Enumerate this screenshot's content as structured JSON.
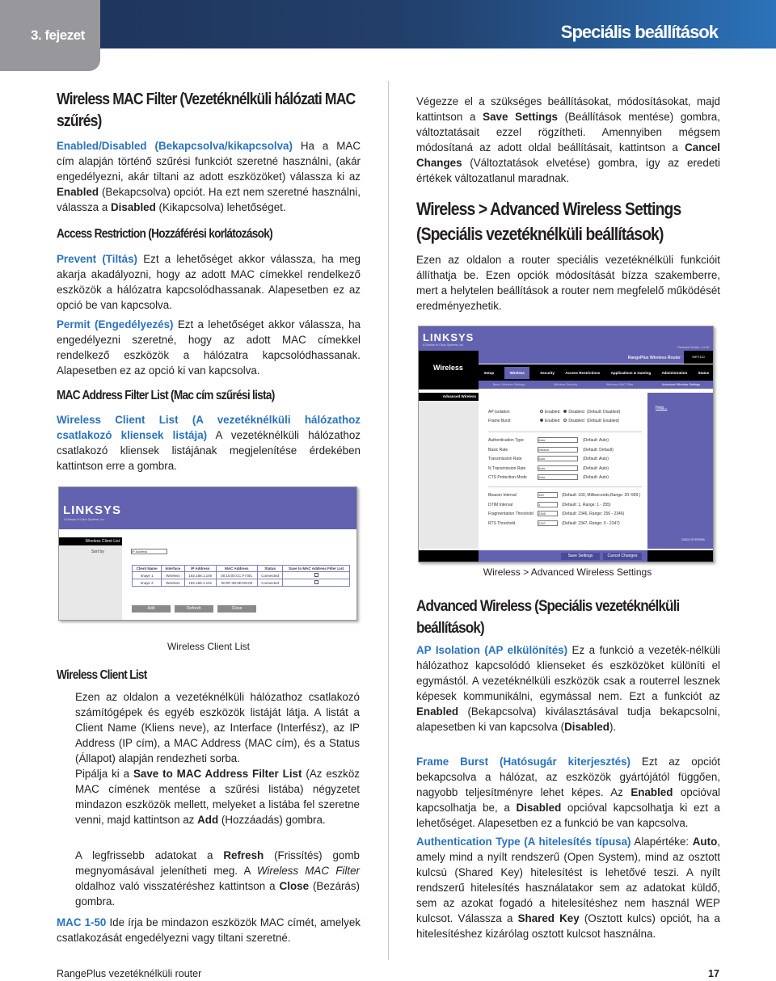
{
  "header": {
    "chapter": "3. fejezet",
    "title": "Speciális beállítások"
  },
  "colors": {
    "accent_blue": "#2a72bd",
    "header_dark": "#1e3358",
    "header_light": "#2b72b9",
    "tab_gray": "#98989c",
    "router_purple": "#6262b0"
  },
  "left": {
    "h_mac_filter": "Wireless MAC Filter (Vezetéknélküli hálózati MAC szűrés)",
    "p_enabled": [
      {
        "t": "Enabled/Disabled (Bekapcsolva/kikapcsolva)",
        "s": "blue"
      },
      {
        "t": " Ha a MAC cím alapján történő szűrési funkciót szeretné használni, (akár engedélyezni, akár tiltani az adott eszközöket) válassza ki az "
      },
      {
        "t": "Enabled",
        "s": "b"
      },
      {
        "t": " (Bekapcsolva) opciót. Ha ezt nem szeretné használni, válassza a "
      },
      {
        "t": "Disabled",
        "s": "b"
      },
      {
        "t": " (Kikapcsolva) lehetőséget."
      }
    ],
    "h_access": "Access Restriction (Hozzáférési korlátozások)",
    "p_prevent": [
      {
        "t": "Prevent (Tiltás)",
        "s": "blue"
      },
      {
        "t": " Ezt a lehetőséget akkor válassza, ha meg akarja akadályozni, hogy az adott MAC címekkel rendelkező eszközök a hálózatra kapcsolódhassanak. Alapesetben ez az opció be van kapcsolva."
      }
    ],
    "p_permit": [
      {
        "t": "Permit (Engedélyezés)",
        "s": "blue"
      },
      {
        "t": " Ezt a lehetőséget akkor válassza, ha engedélyezni szeretné, hogy az adott MAC címekkel rendelkező eszközök a hálózatra kapcsolódhassanak. Alapesetben ez az opció ki van kapcsolva."
      }
    ],
    "h_list": "MAC Address Filter List (Mac cím szűrési lista)",
    "p_client": [
      {
        "t": "Wireless Client List (A vezetéknélküli hálózathoz csatlakozó kliensek listája)",
        "s": "blue"
      },
      {
        "t": " A vezetéknélküli hálózathoz csatlakozó kliensek listájának megjelenítése érdekében kattintson erre a gombra."
      }
    ],
    "caption": "Wireless Client List",
    "h_wcl": "Wireless Client List",
    "p_wcl1": [
      {
        "t": "Ezen az oldalon a vezetéknélküli hálózathoz csatlakozó számítógépek és egyéb eszközök listáját látja. A listát a Client Name (Kliens neve), az Interface (Interfész), az IP Address (IP cím), a MAC Address (MAC cím), és a Status (Állapot) alapján rendezheti sorba."
      }
    ],
    "p_wcl2": [
      {
        "t": "Pipálja ki a "
      },
      {
        "t": "Save to MAC Address Filter List",
        "s": "b"
      },
      {
        "t": " (Az eszköz MAC címének mentése a szűrési listába) négyzetet mindazon eszközök mellett, melyeket a listába fel szeretne venni, majd kattintson az "
      },
      {
        "t": "Add",
        "s": "b"
      },
      {
        "t": " (Hozzáadás) gombra."
      }
    ],
    "p_wcl3": [
      {
        "t": "A legfrissebb adatokat a "
      },
      {
        "t": "Refresh",
        "s": "b"
      },
      {
        "t": " (Frissítés) gomb megnyomásával jelenítheti meg. A "
      },
      {
        "t": "Wireless MAC Filter",
        "s": "i"
      },
      {
        "t": " oldalhoz való visszatéréshez kattintson a "
      },
      {
        "t": "Close",
        "s": "b"
      },
      {
        "t": " (Bezárás) gombra."
      }
    ],
    "p_mac150": [
      {
        "t": "MAC 1-50",
        "s": "blue"
      },
      {
        "t": " Ide írja be mindazon eszközök MAC címét, amelyek csatlakozását engedélyezni vagy tiltani szeretné."
      }
    ]
  },
  "right": {
    "p_save": [
      {
        "t": "Végezze el a szükséges beállításokat, módosításokat, majd kattintson a "
      },
      {
        "t": "Save Settings",
        "s": "b"
      },
      {
        "t": " (Beállítások mentése) gombra, változtatásait ezzel rögzítheti. Amennyiben mégsem módosítaná az adott oldal beállításait, kattintson a "
      },
      {
        "t": "Cancel Changes",
        "s": "b"
      },
      {
        "t": " (Változtatások elvetése) gombra, így az eredeti értékek változatlanul maradnak."
      }
    ],
    "h_adv_settings": "Wireless > Advanced Wireless Settings (Speciális vezetéknélküli beállítások)",
    "p_intro": [
      {
        "t": "Ezen az oldalon a router speciális vezetéknélküli funkcióit állíthatja be. Ezen opciók módosítását bízza szakemberre, mert a helytelen beállítások a router nem megfelelő működését eredményezhetik."
      }
    ],
    "caption": "Wireless > Advanced Wireless Settings",
    "h_adv": "Advanced Wireless (Speciális vezetéknélküli beállítások)",
    "p_ap": [
      {
        "t": "AP Isolation (AP elkülönítés)",
        "s": "blue"
      },
      {
        "t": " Ez a funkció a vezeték-nélküli hálózathoz kapcsolódó klienseket és eszközöket különíti el egymástól. A vezetéknélküli eszközök csak a routerrel lesznek képesek kommunikálni, egymással nem. Ezt a funkciót az "
      },
      {
        "t": "Enabled",
        "s": "b"
      },
      {
        "t": " (Bekapcsolva) kiválasztásával tudja bekapcsolni, alapesetben ki van kapcsolva ("
      },
      {
        "t": "Disabled",
        "s": "b"
      },
      {
        "t": ")."
      }
    ],
    "p_frame": [
      {
        "t": "Frame Burst (Hatósugár kiterjesztés)",
        "s": "blue"
      },
      {
        "t": " Ezt az opciót bekapcsolva a hálózat, az eszközök gyártójától függően, nagyobb teljesítményre lehet képes. Az "
      },
      {
        "t": "Enabled",
        "s": "b"
      },
      {
        "t": " opcióval kapcsolhatja be, a "
      },
      {
        "t": "Disabled",
        "s": "b"
      },
      {
        "t": " opcióval kapcsolhatja ki ezt a lehetőséget. Alapesetben ez a funkció be van kapcsolva."
      }
    ],
    "p_auth": [
      {
        "t": "Authentication Type (A hitelesítés típusa)",
        "s": "blue"
      },
      {
        "t": " Alapértéke: "
      },
      {
        "t": "Auto",
        "s": "b"
      },
      {
        "t": ", amely mind a nyílt rendszerű (Open System), mind az osztott kulcsú (Shared Key) hitelesítést is lehetővé teszi. A nyílt rendszerű hitelesítés használatakor sem az adatokat küldő, sem az azokat fogadó a hitelesítéshez nem használ WEP kulcsot. Válassza a "
      },
      {
        "t": "Shared Key",
        "s": "b"
      },
      {
        "t": " (Osztott kulcs) opciót, ha a hitelesítéshez kizárólag osztott kulcsot használna."
      }
    ]
  },
  "client_shot": {
    "logo": "LINKSYS",
    "logo_sub": "A Division of Cisco Systems, Inc.",
    "section": "Wireless Client List",
    "sort_label": "Sort by",
    "sort_value": "IP Address",
    "columns": [
      "Client Name",
      "Interface",
      "IP Address",
      "MAC Address",
      "Status",
      "Save to MAC Address Filter List"
    ],
    "rows": [
      [
        "Imaye 1",
        "Wireless",
        "192.168.1.100",
        "00:15:00:CC:F7:BC",
        "Connected"
      ],
      [
        "Imaye 2",
        "Wireless",
        "192.168.1.101",
        "00:0F:3D:0E:D8:00",
        "Connected"
      ]
    ],
    "buttons": [
      "Add",
      "Refresh",
      "Close"
    ]
  },
  "adv_shot": {
    "logo": "LINKSYS",
    "logo_sub": "A Division of Cisco Systems, Inc.",
    "firmware": "Firmware Version: 1.0.00",
    "product": "RangePlus Wireless Router",
    "model": "WRT110",
    "section": "Wireless",
    "tabs": [
      "Setup",
      "Wireless",
      "Security",
      "Access Restrictions",
      "Applications & Gaming",
      "Administration",
      "Status"
    ],
    "subtabs": [
      "Basic Wireless Settings",
      "Wireless Security",
      "Wireless MAC Filter",
      "Advanced Wireless Settings"
    ],
    "side": "Advanced Wireless",
    "help": "Help...",
    "radios": [
      {
        "label": "AP Isolation",
        "opt1": "Enabled",
        "opt2": "Disabled",
        "note": "(Default: Disabled)",
        "selected": "Disabled"
      },
      {
        "label": "Frame Burst",
        "opt1": "Enabled",
        "opt2": "Disabled",
        "note": "(Default: Enabled)",
        "selected": "Enabled"
      }
    ],
    "selects": [
      {
        "label": "Authentication Type",
        "value": "Auto",
        "note": "(Default: Auto)"
      },
      {
        "label": "Basic Rate",
        "value": "Default",
        "note": "(Default: Default)"
      },
      {
        "label": "Transmission Rate",
        "value": "Auto",
        "note": "(Default: Auto)"
      },
      {
        "label": "N Transmission Rate",
        "value": "Auto",
        "note": "(Default: Auto)"
      },
      {
        "label": "CTS Protection Mode",
        "value": "Auto",
        "note": "(Default: Auto)"
      }
    ],
    "inputs": [
      {
        "label": "Beacon Interval",
        "value": "100",
        "note": "(Default: 100, Milliseconds,Range: 20~999 )"
      },
      {
        "label": "DTIM Interval",
        "value": "1",
        "note": "(Default: 1, Range: 1 - 255)"
      },
      {
        "label": "Fragmentation Threshold",
        "value": "2346",
        "note": "(Default: 2346, Range: 256 - 2346)"
      },
      {
        "label": "RTS Threshold",
        "value": "2347",
        "note": "(Default: 2347, Range: 0 - 2347)"
      }
    ],
    "buttons": [
      "Save Settings",
      "Cancel Changes"
    ],
    "cisco": "CISCO SYSTEMS"
  },
  "footer": {
    "product": "RangePlus vezetéknélküli router",
    "page": "17"
  }
}
